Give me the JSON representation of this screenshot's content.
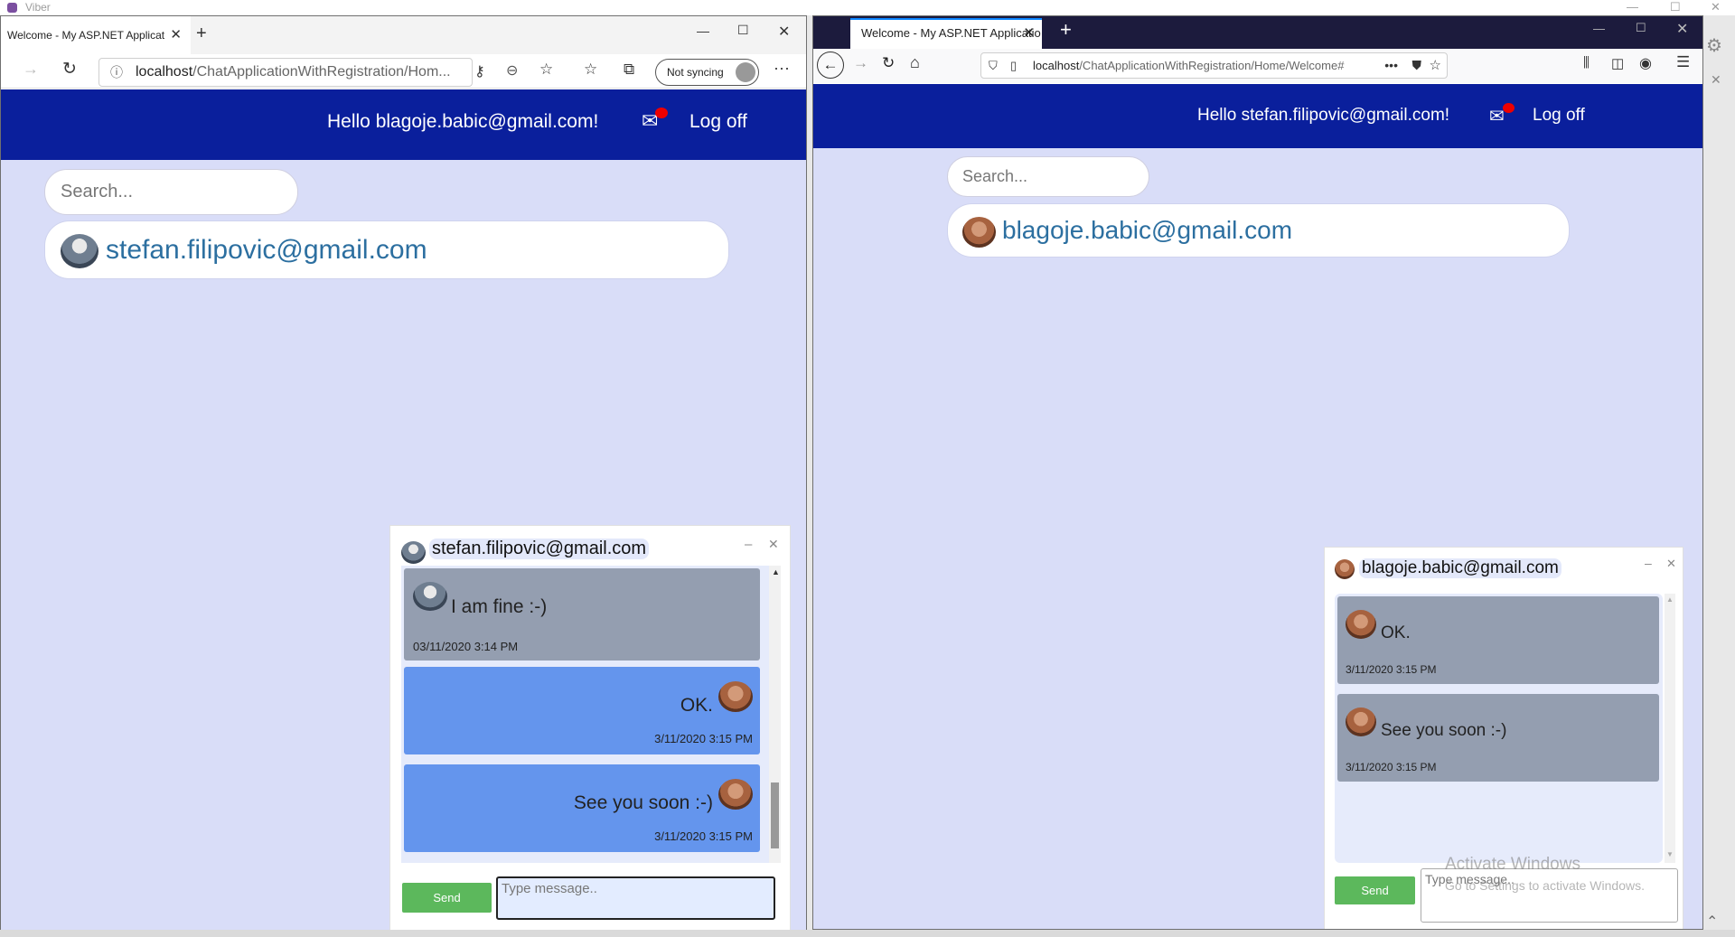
{
  "viber": {
    "title": "Viber"
  },
  "left": {
    "tab_title": "Welcome - My ASP.NET Applicat",
    "url_host": "localhost",
    "url_path": "/ChatApplicationWithRegistration/Hom...",
    "sync_label": "Not syncing",
    "hello": "Hello blagoje.babic@gmail.com!",
    "logoff": "Log off",
    "search_placeholder": "Search...",
    "contact": "stefan.filipovic@gmail.com",
    "chat": {
      "title": "stefan.filipovic@gmail.com",
      "messages": [
        {
          "text": "I am fine :-)",
          "time": "03/11/2020 3:14 PM",
          "dir": "received"
        },
        {
          "text": "OK.",
          "time": "3/11/2020 3:15 PM",
          "dir": "sent"
        },
        {
          "text": "See you soon :-)",
          "time": "3/11/2020 3:15 PM",
          "dir": "sent"
        }
      ],
      "send": "Send",
      "placeholder": "Type message.."
    }
  },
  "right": {
    "tab_title": "Welcome - My ASP.NET Applicatio",
    "url_host": "localhost",
    "url_path": "/ChatApplicationWithRegistration/Home/Welcome#",
    "hello": "Hello stefan.filipovic@gmail.com!",
    "logoff": "Log off",
    "search_placeholder": "Search...",
    "contact": "blagoje.babic@gmail.com",
    "chat": {
      "title": "blagoje.babic@gmail.com",
      "messages": [
        {
          "text": "OK.",
          "time": "3/11/2020 3:15 PM",
          "dir": "received"
        },
        {
          "text": "See you soon :-)",
          "time": "3/11/2020 3:15 PM",
          "dir": "received"
        }
      ],
      "send": "Send",
      "placeholder": "Type message.."
    }
  },
  "watermark": {
    "line1": "Activate Windows",
    "line2": "Go to Settings to activate Windows."
  },
  "colors": {
    "navband": "#0a1f9c",
    "content_bg": "#d9ddf8",
    "sent_bubble": "#6495ed",
    "received_bubble": "#949eb0",
    "send_button": "#5cb85c"
  }
}
